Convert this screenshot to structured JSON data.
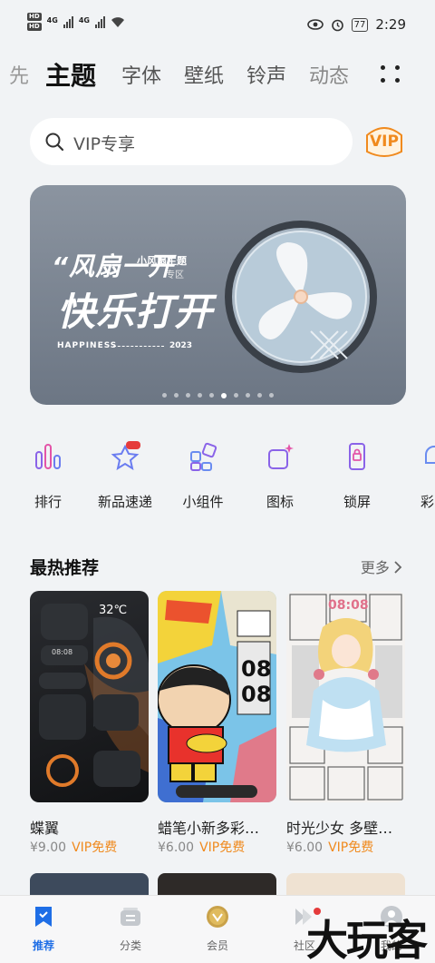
{
  "status_bar": {
    "hd1": "HD",
    "hd2": "HD",
    "net1": "4G",
    "net2": "4G",
    "battery": "77",
    "time": "2:29"
  },
  "tabs": {
    "items": [
      {
        "label": "先"
      },
      {
        "label": "主题"
      },
      {
        "label": "字体"
      },
      {
        "label": "壁纸"
      },
      {
        "label": "铃声"
      },
      {
        "label": "动态"
      }
    ],
    "active_index": 1
  },
  "search": {
    "placeholder": "VIP专享",
    "vip_label": "VIP"
  },
  "banner": {
    "quote": "“风扇一开",
    "sub_title": "小风扇主题",
    "sub_tag": "专区",
    "main_text": "快乐打开",
    "tagline": "HAPPINESS",
    "year": "2023",
    "page_count": 10,
    "active_page": 5
  },
  "quick_links": [
    {
      "label": "排行",
      "icon": "ranking-icon"
    },
    {
      "label": "新品速递",
      "icon": "star-new-icon",
      "badge": "NEW"
    },
    {
      "label": "小组件",
      "icon": "widget-icon"
    },
    {
      "label": "图标",
      "icon": "icon-pack-icon"
    },
    {
      "label": "锁屏",
      "icon": "lock-screen-icon"
    },
    {
      "label": "彩",
      "icon": "bell-icon"
    }
  ],
  "hot_section": {
    "title": "最热推荐",
    "more": "更多",
    "cards": [
      {
        "name": "蝶翼",
        "price": "¥9.00",
        "vip": "VIP免费",
        "preview_time": "32℃",
        "preview_clock": "08:08"
      },
      {
        "name": "蜡笔小新多彩…",
        "price": "¥6.00",
        "vip": "VIP免费",
        "preview_time": "08",
        "preview_clock": "08"
      },
      {
        "name": "时光少女 多壁…",
        "price": "¥6.00",
        "vip": "VIP免费",
        "preview_time": "08:08",
        "preview_clock": ""
      }
    ]
  },
  "bottom_nav": {
    "items": [
      {
        "label": "推荐",
        "icon": "recommend-icon"
      },
      {
        "label": "分类",
        "icon": "category-icon"
      },
      {
        "label": "会员",
        "icon": "member-icon"
      },
      {
        "label": "社区",
        "icon": "community-icon"
      },
      {
        "label": "我的",
        "icon": "profile-icon"
      }
    ],
    "active_index": 0
  },
  "watermark": "大玩客",
  "colors": {
    "accent": "#1e6ee6",
    "vip_orange": "#f08a1e",
    "background": "#f1f3f5"
  }
}
